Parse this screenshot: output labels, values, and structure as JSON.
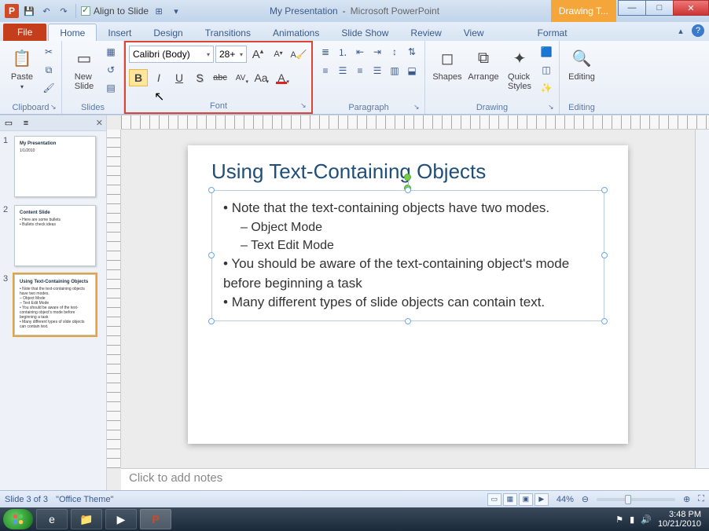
{
  "qat": {
    "align_label": "Align to Slide"
  },
  "title": {
    "document": "My Presentation",
    "app": "Microsoft PowerPoint",
    "context_tab": "Drawing T..."
  },
  "tabs": {
    "file": "File",
    "home": "Home",
    "insert": "Insert",
    "design": "Design",
    "transitions": "Transitions",
    "animations": "Animations",
    "slideshow": "Slide Show",
    "review": "Review",
    "view": "View",
    "format": "Format"
  },
  "ribbon": {
    "clipboard": {
      "label": "Clipboard",
      "paste": "Paste"
    },
    "slides": {
      "label": "Slides",
      "new_slide": "New\nSlide"
    },
    "font": {
      "label": "Font",
      "name": "Calibri (Body)",
      "size": "28+",
      "grow": "A",
      "shrink": "A",
      "clear": "Aa",
      "bold": "B",
      "italic": "I",
      "underline": "U",
      "shadow": "S",
      "strike": "abc",
      "spacing": "AV",
      "case": "Aa",
      "color": "A"
    },
    "paragraph": {
      "label": "Paragraph"
    },
    "drawing": {
      "label": "Drawing",
      "shapes": "Shapes",
      "arrange": "Arrange",
      "quick_styles": "Quick\nStyles"
    },
    "editing": {
      "label": "Editing",
      "btn": "Editing"
    }
  },
  "thumbs": {
    "items": [
      {
        "num": "1",
        "title": "My Presentation",
        "lines": [
          "1/1/2010"
        ]
      },
      {
        "num": "2",
        "title": "Content Slide",
        "lines": [
          "• Here are some bullets",
          "• Bullets check ideas"
        ]
      },
      {
        "num": "3",
        "title": "Using Text-Containing Objects",
        "lines": [
          "• Note that the text-containing objects have two modes.",
          "  – Object Mode",
          "  – Text Edit Mode",
          "• You should be aware of the text-containing object's mode before beginning a task",
          "• Many different types of slide objects can contain text."
        ]
      }
    ]
  },
  "slide": {
    "title": "Using Text-Containing Objects",
    "b1": "Note that the text-containing objects have two modes.",
    "b1a": "Object Mode",
    "b1b": "Text Edit Mode",
    "b2": "You should be aware of the text-containing object's mode before beginning a task",
    "b3": "Many different types of slide objects can contain text."
  },
  "notes": {
    "placeholder": "Click to add notes"
  },
  "status": {
    "slide": "Slide 3 of 3",
    "theme": "\"Office Theme\"",
    "zoom": "44%"
  },
  "taskbar": {
    "time": "3:48 PM",
    "date": "10/21/2010"
  }
}
